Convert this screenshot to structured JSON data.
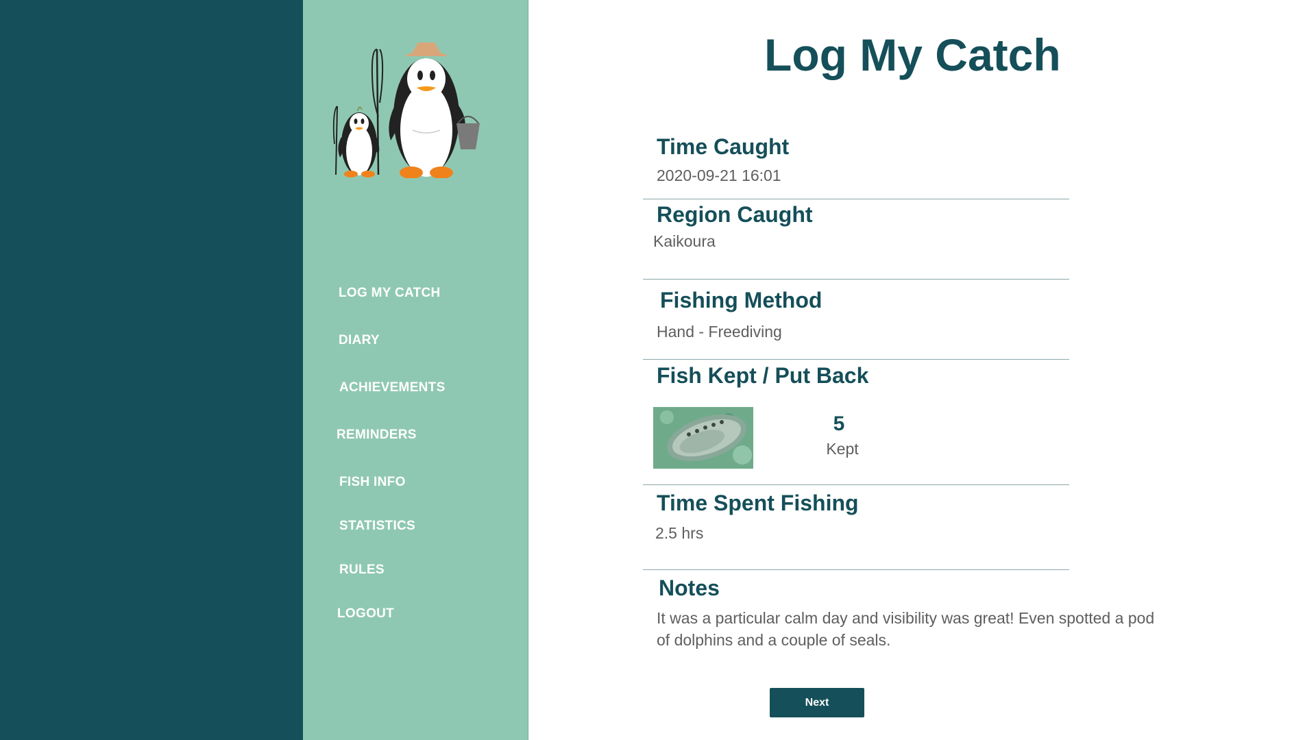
{
  "sidebar": {
    "logo_icon": "penguin-fishing-family-logo",
    "items": [
      {
        "label": "LOG MY CATCH"
      },
      {
        "label": "DIARY"
      },
      {
        "label": "ACHIEVEMENTS"
      },
      {
        "label": "REMINDERS"
      },
      {
        "label": "FISH INFO"
      },
      {
        "label": "STATISTICS"
      },
      {
        "label": "RULES"
      },
      {
        "label": "LOGOUT"
      }
    ]
  },
  "main": {
    "title": "Log My Catch",
    "time_caught": {
      "label": "Time Caught",
      "value": "2020-09-21 16:01"
    },
    "region_caught": {
      "label": "Region Caught",
      "value": "Kaikoura"
    },
    "fishing_method": {
      "label": "Fishing Method",
      "value": "Hand - Freediving"
    },
    "fish_kept": {
      "label": "Fish Kept / Put Back",
      "photo_icon": "paua-shellfish-photo",
      "count": "5",
      "status": "Kept"
    },
    "time_spent": {
      "label": "Time Spent Fishing",
      "value": "2.5 hrs"
    },
    "notes": {
      "label": "Notes",
      "text": "It was a particular calm day and visibility was great!  Even spotted a pod of dolphins and a couple of seals."
    },
    "next_label": "Next"
  },
  "colors": {
    "dark_teal": "#154f59",
    "sidebar_green": "#8fc8b2",
    "text_gray": "#5e5e5e",
    "divider": "#8aa8aa"
  }
}
